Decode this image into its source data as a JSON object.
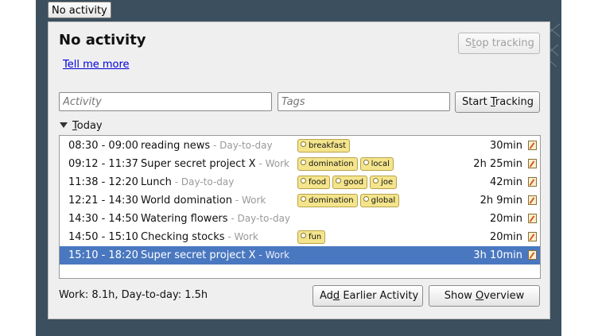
{
  "tray": {
    "label": "No activity"
  },
  "window": {
    "title": "No activity",
    "tell_more": "Tell me more",
    "stop_button": {
      "before": "S",
      "key": "t",
      "after": "op tracking"
    },
    "activity_placeholder": "Activity",
    "tags_placeholder": "Tags",
    "start_button": {
      "before": "Start ",
      "key": "T",
      "after": "racking"
    },
    "day_label": {
      "before": "",
      "key": "T",
      "after": "oday"
    },
    "activities": [
      {
        "time": "08:30 - 09:00",
        "name": "reading news",
        "category": "Day-to-day",
        "tags": [
          "breakfast"
        ],
        "duration": "30min"
      },
      {
        "time": "09:12 - 11:37",
        "name": "Super secret project X",
        "category": "Work",
        "tags": [
          "domination",
          "local"
        ],
        "duration": "2h 25min"
      },
      {
        "time": "11:38 - 12:20",
        "name": "Lunch",
        "category": "Day-to-day",
        "tags": [
          "food",
          "good",
          "joe"
        ],
        "duration": "42min"
      },
      {
        "time": "12:21 - 14:30",
        "name": "World domination",
        "category": "Work",
        "tags": [
          "domination",
          "global"
        ],
        "duration": "2h 9min"
      },
      {
        "time": "14:30 - 14:50",
        "name": "Watering flowers",
        "category": "Day-to-day",
        "tags": [],
        "duration": "20min"
      },
      {
        "time": "14:50 - 15:10",
        "name": "Checking stocks",
        "category": "Work",
        "tags": [
          "fun"
        ],
        "duration": "20min"
      },
      {
        "time": "15:10 - 18:20",
        "name": "Super secret project X",
        "category": "Work",
        "tags": [],
        "duration": "3h 10min",
        "selected": true
      }
    ],
    "category_separator": " - ",
    "totals": "Work: 8.1h, Day-to-day: 1.5h",
    "add_earlier": {
      "before": "Ad",
      "key": "d",
      "after": " Earlier Activity"
    },
    "overview": {
      "before": "Show ",
      "key": "O",
      "after": "verview"
    }
  }
}
